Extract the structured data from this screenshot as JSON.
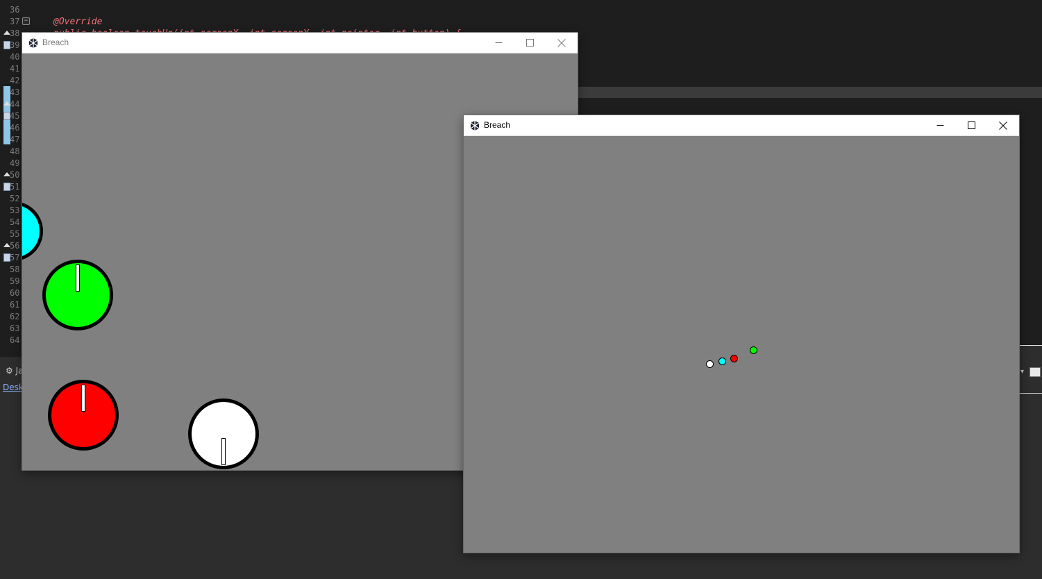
{
  "ide": {
    "line_numbers": [
      "36",
      "37",
      "38",
      "39",
      "40",
      "41",
      "42",
      "43",
      "44",
      "45",
      "46",
      "47",
      "48",
      "49",
      "50",
      "51",
      "52",
      "53",
      "54",
      "55",
      "56",
      "57",
      "58",
      "59",
      "60",
      "61",
      "62",
      "63",
      "64"
    ],
    "code_lines": [
      {
        "text": "@Override",
        "color": "#f07178"
      },
      {
        "text": "public boolean touchUp(int screenX, int screenY, int pointer, int button) {",
        "color": "#f07178"
      }
    ],
    "fold_symbol": "−",
    "lower_tab_label": "Ja",
    "lower_tab2_label": "Deskt"
  },
  "windows": [
    {
      "title": "Breach",
      "title_color": "#7a7a7a",
      "focused": false,
      "icons": {
        "app": "app-icon",
        "minimize": "minimize-icon",
        "maximize": "maximize-icon",
        "close": "close-icon"
      }
    },
    {
      "title": "Breach",
      "title_color": "#000000",
      "focused": true,
      "icons": {
        "app": "app-icon",
        "minimize": "minimize-icon",
        "maximize": "maximize-icon",
        "close": "close-icon"
      }
    }
  ],
  "game": {
    "background_color": "#808080",
    "ball_colors": {
      "cyan": "#00ffff",
      "green": "#00ff00",
      "red": "#ff0000",
      "white": "#ffffff"
    },
    "outline_color": "#000000"
  }
}
